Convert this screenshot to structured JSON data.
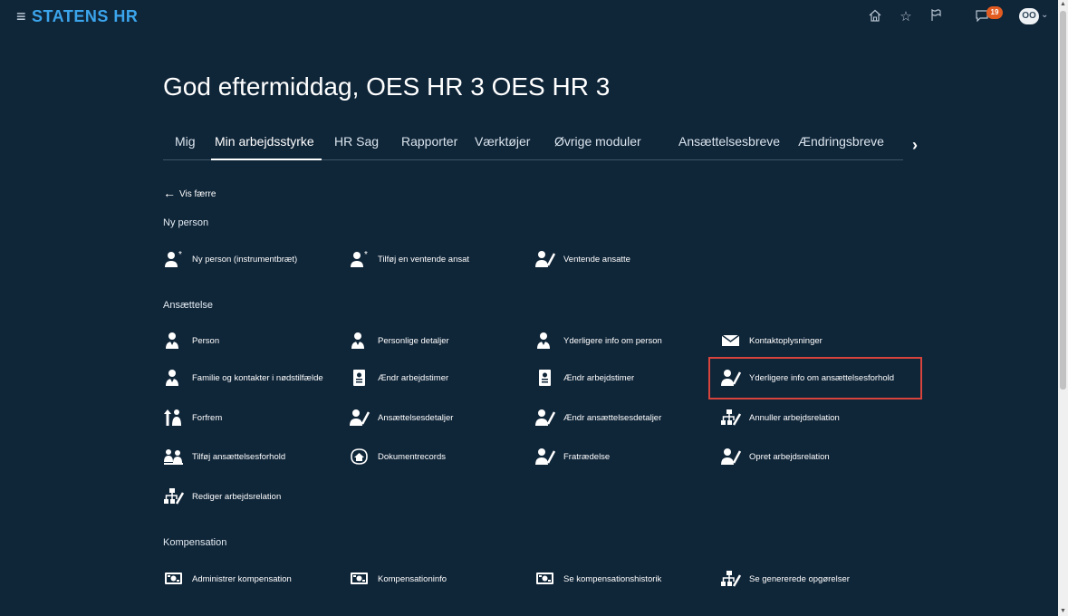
{
  "header": {
    "brand": "STATENS HR",
    "notification_count": "19",
    "avatar_initials": "OO"
  },
  "greeting": "God eftermiddag, OES HR 3 OES HR 3",
  "tabs": [
    "Mig",
    "Min arbejdsstyrke",
    "HR Sag",
    "Rapporter",
    "Værktøjer",
    "Øvrige moduler",
    "Ansættelsesbreve",
    "Ændringsbreve"
  ],
  "active_tab": "Min arbejdsstyrke",
  "back_label": "Vis færre",
  "sections": {
    "ny_person": "Ny person",
    "ansaettelse": "Ansættelse",
    "kompensation": "Kompensation"
  },
  "items": {
    "ny_person": [
      "Ny person (instrumentbræt)",
      "Tilføj en ventende ansat",
      "Ventende ansatte"
    ],
    "ansaettelse": [
      "Person",
      "Personlige detaljer",
      "Yderligere info om person",
      "Kontaktoplysninger",
      "Familie og kontakter i nødstilfælde",
      "Ændr arbejdstimer",
      "Ændr arbejdstimer",
      "Yderligere info om ansættelsesforhold",
      "Forfrem",
      "Ansættelsesdetaljer",
      "Ændr ansættelsesdetaljer",
      "Annuller arbejdsrelation",
      "Tilføj ansættelsesforhold",
      "Dokumentrecords",
      "Fratrædelse",
      "Opret arbejdsrelation",
      "Rediger arbejdsrelation"
    ],
    "kompensation": [
      "Administrer kompensation",
      "Kompensationinfo",
      "Se kompensationshistorik",
      "Se genererede opgørelser"
    ]
  },
  "colors": {
    "background": "#0f2538",
    "brand": "#3ba5ec",
    "highlight": "#d7443c",
    "badge": "#e25b21"
  }
}
